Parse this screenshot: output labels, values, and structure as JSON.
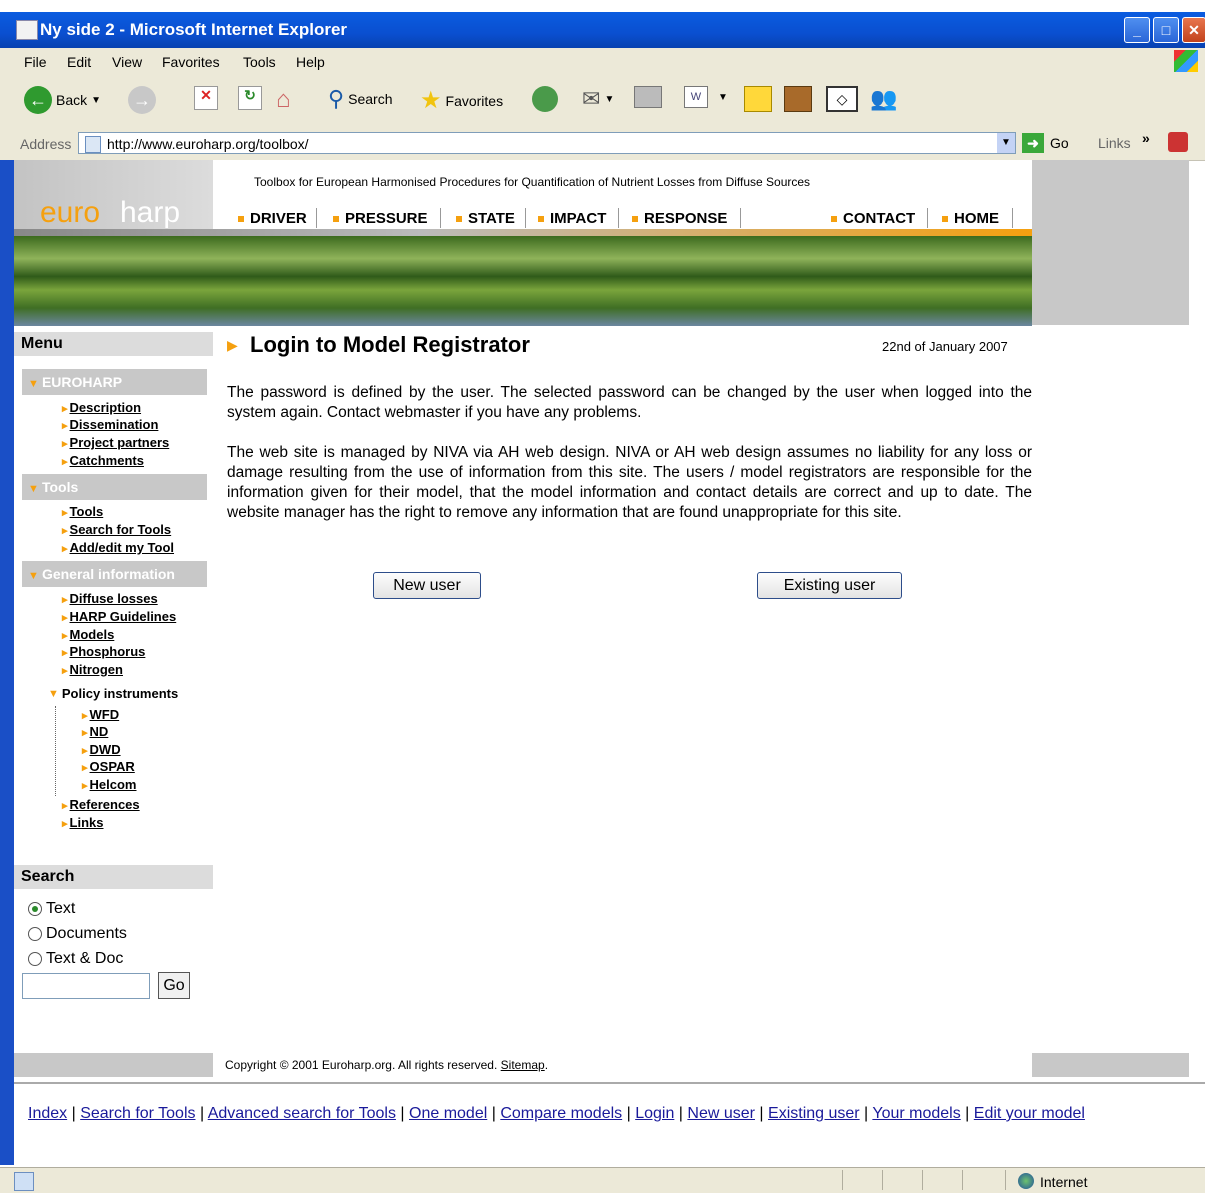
{
  "window": {
    "title": "Ny side 2 - Microsoft Internet Explorer"
  },
  "menubar": [
    "File",
    "Edit",
    "View",
    "Favorites",
    "Tools",
    "Help"
  ],
  "toolbar": {
    "back": "Back",
    "search": "Search",
    "favorites": "Favorites"
  },
  "address": {
    "label": "Address",
    "url": "http://www.euroharp.org/toolbox/",
    "go": "Go",
    "links": "Links"
  },
  "site": {
    "logo_euro": "euro",
    "logo_harp": "harp",
    "tagline": "Toolbox for European Harmonised Procedures for Quantification of Nutrient Losses from Diffuse Sources",
    "nav": [
      "DRIVER",
      "PRESSURE",
      "STATE",
      "IMPACT",
      "RESPONSE",
      "CONTACT",
      "HOME"
    ]
  },
  "sidebar": {
    "menu_title": "Menu",
    "euroharp": {
      "title": "EUROHARP",
      "items": [
        "Description",
        "Dissemination",
        "Project partners",
        "Catchments"
      ]
    },
    "tools": {
      "title": "Tools",
      "items": [
        "Tools",
        "Search for Tools",
        "Add/edit my Tool"
      ]
    },
    "general": {
      "title": "General information",
      "items": [
        "Diffuse losses",
        "HARP Guidelines",
        "Models",
        "Phosphorus",
        "Nitrogen"
      ]
    },
    "policy": {
      "title": "Policy instruments",
      "items": [
        "WFD",
        "ND",
        "DWD",
        "OSPAR",
        "Helcom"
      ]
    },
    "extra": [
      "References",
      "Links"
    ]
  },
  "search": {
    "title": "Search",
    "options": [
      "Text",
      "Documents",
      "Text & Doc"
    ],
    "selected": "Text",
    "go": "Go"
  },
  "main": {
    "title": "Login to Model Registrator",
    "date": "22nd of January 2007",
    "para1": "The password is defined by the user. The selected password can be changed by the user when logged into the system again. Contact webmaster if you have any problems.",
    "para2": "The web site is managed by NIVA via AH web design. NIVA or AH web design assumes no liability for any loss or damage resulting from the use of information from this site. The users / model registrators are responsible for the information given for their model, that the model information and contact details are correct and up to date. The website manager has the right to remove any information that are found unappropriate for this site.",
    "new_user": "New user",
    "existing_user": "Existing user"
  },
  "footer": {
    "copyright": "Copyright © 2001 Euroharp.org. All rights reserved.",
    "sitemap": "Sitemap",
    "links": [
      "Index",
      "Search for Tools",
      "Advanced search for Tools",
      "One model",
      "Compare models",
      "Login",
      "New user",
      "Existing user",
      "Your models",
      "Edit your model"
    ]
  },
  "status": {
    "zone": "Internet"
  }
}
